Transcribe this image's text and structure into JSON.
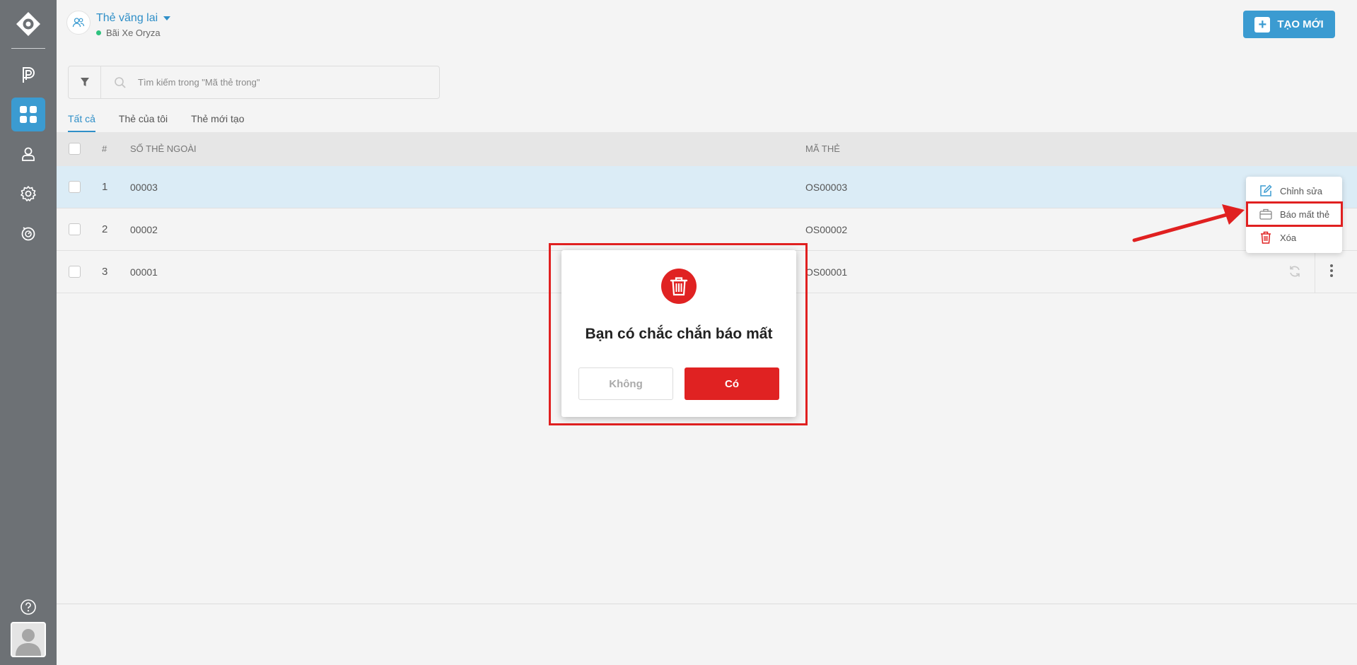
{
  "app": {
    "title": "Thẻ vãng lai",
    "location": "Bãi Xe Oryza",
    "create_button": "TẠO MỚI"
  },
  "search": {
    "placeholder": "Tìm kiếm trong \"Mã thẻ trong\""
  },
  "tabs": [
    {
      "label": "Tất cả",
      "active": true
    },
    {
      "label": "Thẻ của tôi",
      "active": false
    },
    {
      "label": "Thẻ mới tạo",
      "active": false
    }
  ],
  "table": {
    "columns": [
      "#",
      "SỐ THẺ NGOÀI",
      "MÃ THẺ"
    ],
    "rows": [
      {
        "num": "1",
        "ext": "00003",
        "code": "OS00003",
        "selected": true
      },
      {
        "num": "2",
        "ext": "00002",
        "code": "OS00002",
        "selected": false
      },
      {
        "num": "3",
        "ext": "00001",
        "code": "OS00001",
        "selected": false
      }
    ]
  },
  "context_menu": {
    "items": [
      "Chỉnh sửa",
      "Báo mất thẻ",
      "Xóa"
    ]
  },
  "dialog": {
    "title": "Bạn có chắc chắn báo mất",
    "cancel": "Không",
    "confirm": "Có"
  },
  "colors": {
    "sidebar": "#6d7175",
    "accent": "#3b9bd1",
    "danger": "#e02222",
    "status_online": "#2ec27e"
  }
}
